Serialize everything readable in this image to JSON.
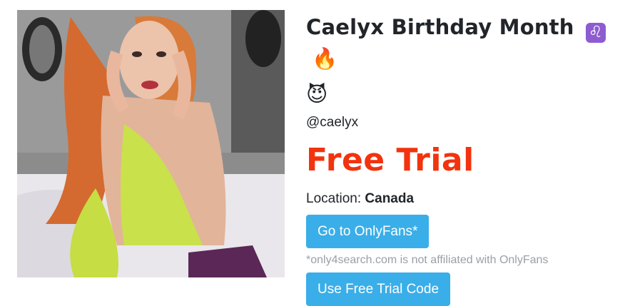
{
  "profile": {
    "name_text": "Caelyx Birthday Month",
    "emoji_zodiac": "♌",
    "emoji_fire": "🔥",
    "emoji_devil": "😈",
    "handle": "@caelyx",
    "offer": "Free Trial",
    "location_label": "Location:",
    "location_value": "Canada"
  },
  "actions": {
    "onlyfans_button": "Go to OnlyFans*",
    "disclaimer": "*only4search.com is not affiliated with OnlyFans",
    "trial_code_button": "Use Free Trial Code"
  },
  "colors": {
    "offer": "#f2330e",
    "button": "#3aaee8",
    "disclaimer": "#9aa0a6"
  }
}
